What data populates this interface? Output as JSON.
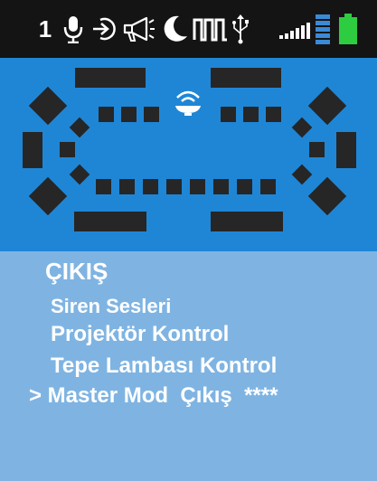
{
  "status_bar": {
    "page_number": "1",
    "icons": [
      "microphone-icon",
      "input-icon",
      "megaphone-icon",
      "night-mode-icon",
      "pulse-wave-icon",
      "usb-icon",
      "signal-strength-icon",
      "volume-bars-icon",
      "battery-icon"
    ],
    "colors": {
      "background": "#141414",
      "volume": "#3b8ad6",
      "battery": "#2ecc40"
    }
  },
  "lightbar": {
    "center_icon": "beacon-light-icon",
    "colors": {
      "background": "#1f86d6",
      "segment": "#262626"
    }
  },
  "menu": {
    "title": "ÇIKIŞ",
    "items": [
      {
        "label": "Siren Sesleri"
      },
      {
        "label": "Projektör Kontrol"
      },
      {
        "label": "Tepe Lambası Kontrol"
      },
      {
        "label": "> Master Mod  Çıkış  ****"
      }
    ],
    "selected_index": 3,
    "colors": {
      "background": "#7fb4e2",
      "text": "#ffffff"
    }
  }
}
